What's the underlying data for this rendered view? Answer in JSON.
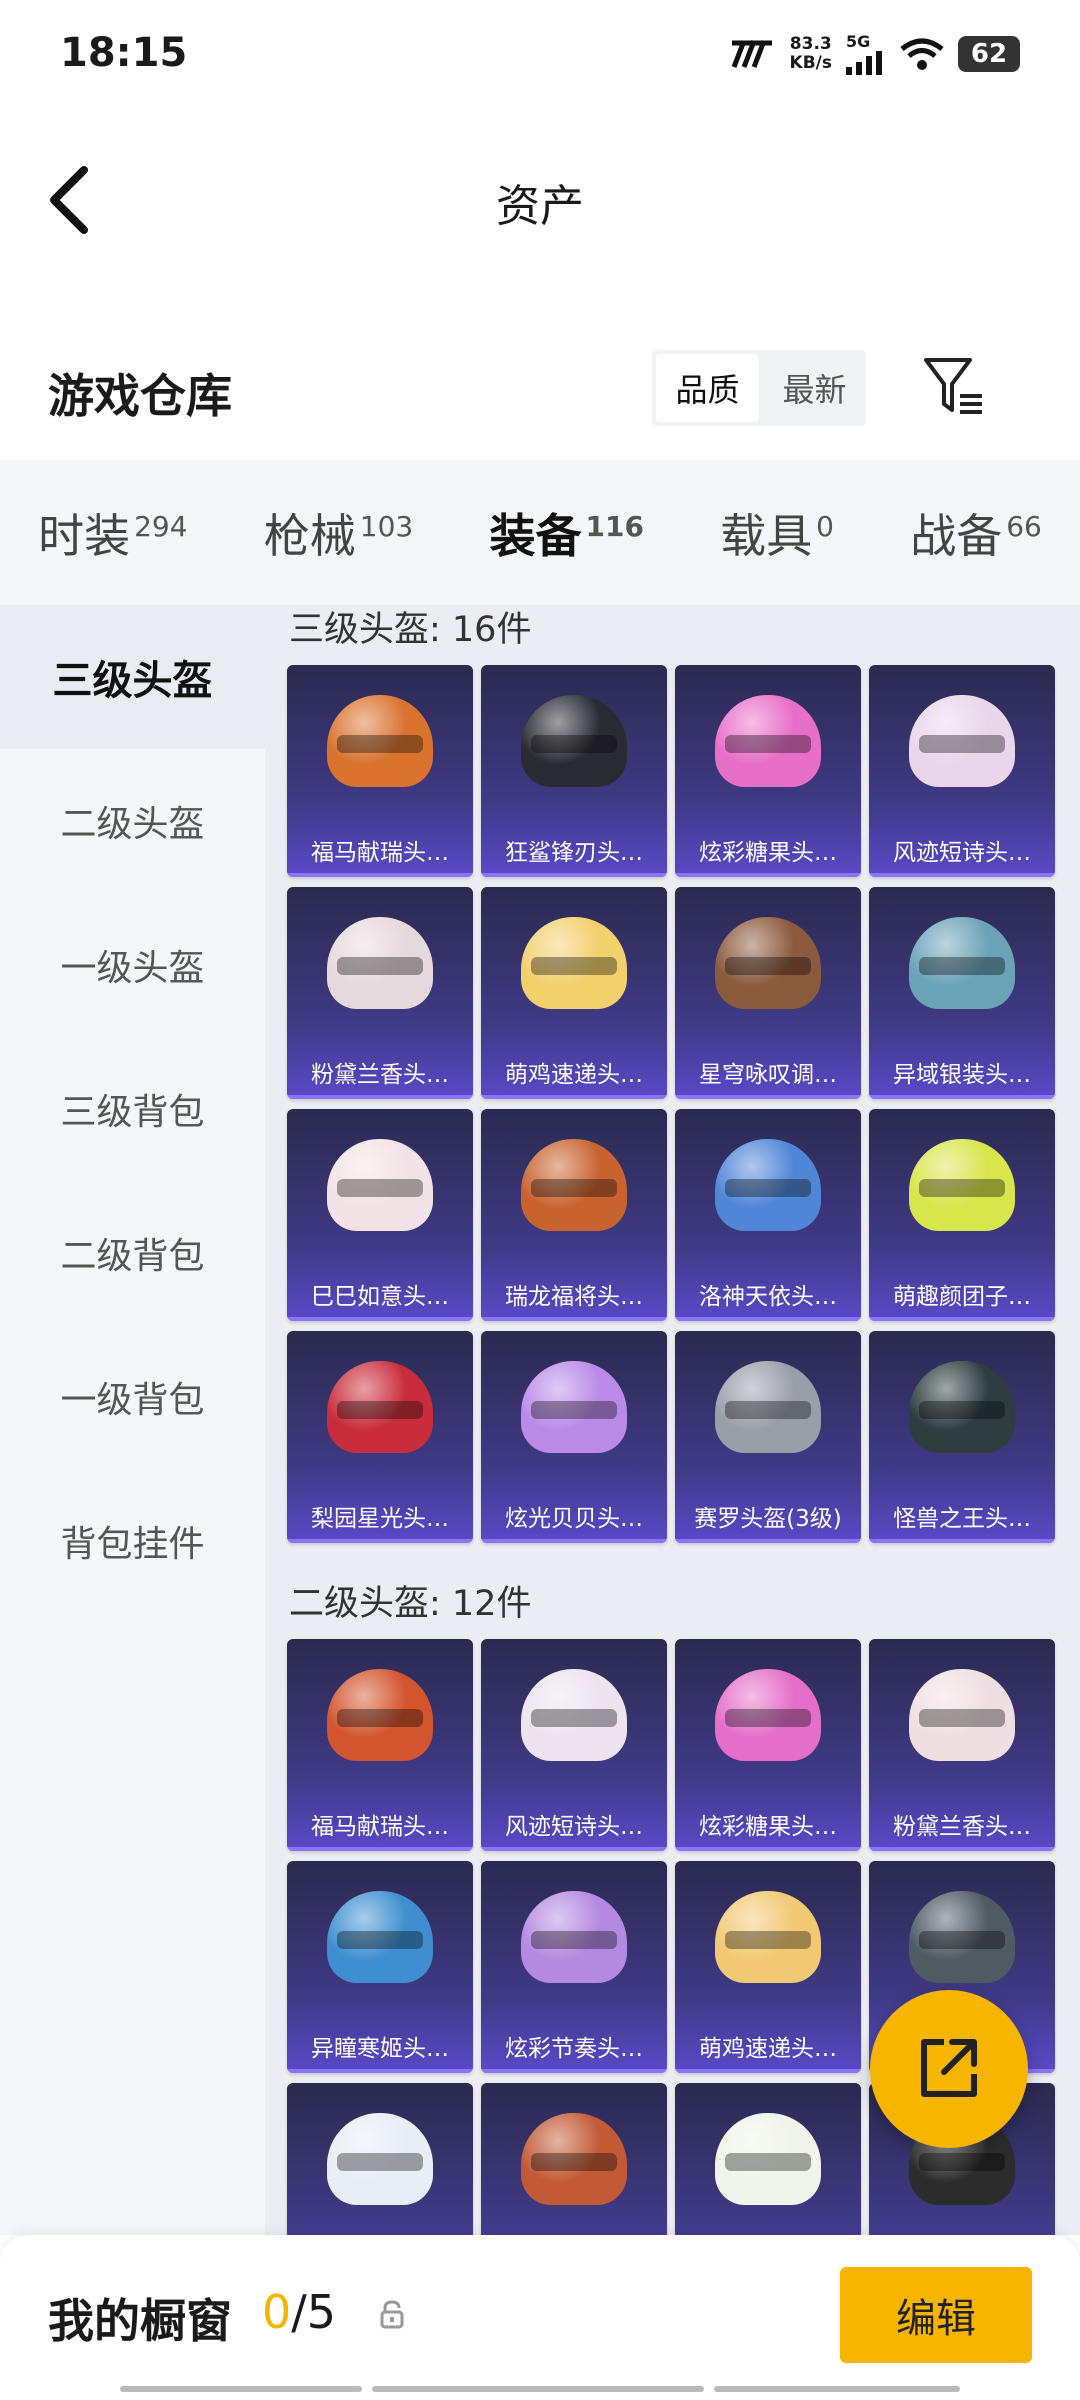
{
  "status": {
    "time": "18:15",
    "speed_value": "83.3",
    "speed_unit": "KB/s",
    "network": "5G",
    "battery": "62"
  },
  "header": {
    "title": "资产"
  },
  "warehouse": {
    "title": "游戏仓库",
    "sort_options": [
      "品质",
      "最新"
    ]
  },
  "tabs": [
    {
      "label": "时装",
      "count": "294"
    },
    {
      "label": "枪械",
      "count": "103"
    },
    {
      "label": "装备",
      "count": "116"
    },
    {
      "label": "载具",
      "count": "0"
    },
    {
      "label": "战备",
      "count": "66"
    }
  ],
  "sidebar": [
    "三级头盔",
    "二级头盔",
    "一级头盔",
    "三级背包",
    "二级背包",
    "一级背包",
    "背包挂件"
  ],
  "sections": [
    {
      "title": "三级头盔: 16件",
      "items": [
        {
          "name": "福马献瑞头…",
          "color": "#d9732e"
        },
        {
          "name": "狂鲨锋刃头…",
          "color": "#2a2a33"
        },
        {
          "name": "炫彩糖果头…",
          "color": "#e86fc8"
        },
        {
          "name": "风迹短诗头…",
          "color": "#e9d6ea"
        },
        {
          "name": "粉黛兰香头…",
          "color": "#e6d9de"
        },
        {
          "name": "萌鸡速递头…",
          "color": "#f2d06c"
        },
        {
          "name": "星穹咏叹调…",
          "color": "#8a5a3c"
        },
        {
          "name": "异域银装头…",
          "color": "#6aa3b6"
        },
        {
          "name": "巳巳如意头…",
          "color": "#f3e3e6"
        },
        {
          "name": "瑞龙福将头…",
          "color": "#c8632f"
        },
        {
          "name": "洛神天依头…",
          "color": "#4f86d6"
        },
        {
          "name": "萌趣颜团子…",
          "color": "#d7e64a"
        },
        {
          "name": "梨园星光头…",
          "color": "#c92d3b"
        },
        {
          "name": "炫光贝贝头…",
          "color": "#b98be6"
        },
        {
          "name": "赛罗头盔(3级)",
          "color": "#9a9ea8"
        },
        {
          "name": "怪兽之王头…",
          "color": "#2f3d3f"
        }
      ]
    },
    {
      "title": "二级头盔: 12件",
      "items": [
        {
          "name": "福马献瑞头…",
          "color": "#d2552e"
        },
        {
          "name": "风迹短诗头…",
          "color": "#ece4ee"
        },
        {
          "name": "炫彩糖果头…",
          "color": "#e46fc8"
        },
        {
          "name": "粉黛兰香头…",
          "color": "#efdfe3"
        },
        {
          "name": "异瞳寒姬头…",
          "color": "#3f8fd0"
        },
        {
          "name": "炫彩节奏头…",
          "color": "#b38ae0"
        },
        {
          "name": "萌鸡速递头…",
          "color": "#f1c972"
        },
        {
          "name": "",
          "color": "#4f5a63"
        },
        {
          "name": "",
          "color": "#e8eef5"
        },
        {
          "name": "",
          "color": "#c25a35"
        },
        {
          "name": "",
          "color": "#f1f4ea"
        },
        {
          "name": "",
          "color": "#2c2c2c"
        }
      ]
    }
  ],
  "bottom": {
    "label": "我的橱窗",
    "current": "0",
    "total": "/5",
    "edit": "编辑"
  }
}
